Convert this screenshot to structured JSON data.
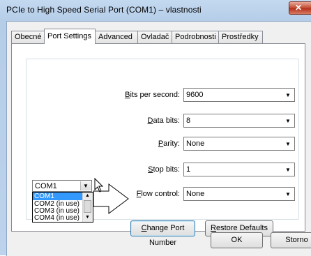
{
  "window": {
    "title": "PCIe to High Speed Serial Port (COM1) – vlastnosti",
    "close_glyph": "✕"
  },
  "tabs": [
    {
      "label": "Obecné",
      "active": false
    },
    {
      "label": "Port Settings",
      "active": true
    },
    {
      "label": "Advanced",
      "active": false
    },
    {
      "label": "Ovladač",
      "active": false
    },
    {
      "label": "Podrobnosti",
      "active": false
    },
    {
      "label": "Prostředky",
      "active": false
    }
  ],
  "settings": {
    "bits_per_second": {
      "accel": "B",
      "rest": "its per second:",
      "value": "9600"
    },
    "data_bits": {
      "accel": "D",
      "rest": "ata bits:",
      "value": "8"
    },
    "parity": {
      "pre": "",
      "accel": "P",
      "rest": "arity:",
      "value": "None"
    },
    "stop_bits": {
      "accel": "S",
      "rest": "top bits:",
      "value": "1"
    },
    "flow_control": {
      "accel": "F",
      "rest": "low control:",
      "value": "None"
    }
  },
  "buttons": {
    "change_port": {
      "accel": "C",
      "rest": "hange Port Number"
    },
    "restore_defaults": {
      "accel": "R",
      "rest": "estore Defaults"
    },
    "ok": "OK",
    "cancel": "Storno"
  },
  "port_dropdown": {
    "selected": "COM1",
    "options": [
      "COM1",
      "COM2 (in use)",
      "COM3 (in use)",
      "COM4 (in use)"
    ]
  },
  "icons": {
    "dropdown_arrow": "▼",
    "scroll_up": "▲",
    "scroll_down": "▼"
  },
  "colors": {
    "selection": "#3399ff",
    "close_button": "#c7533c"
  }
}
